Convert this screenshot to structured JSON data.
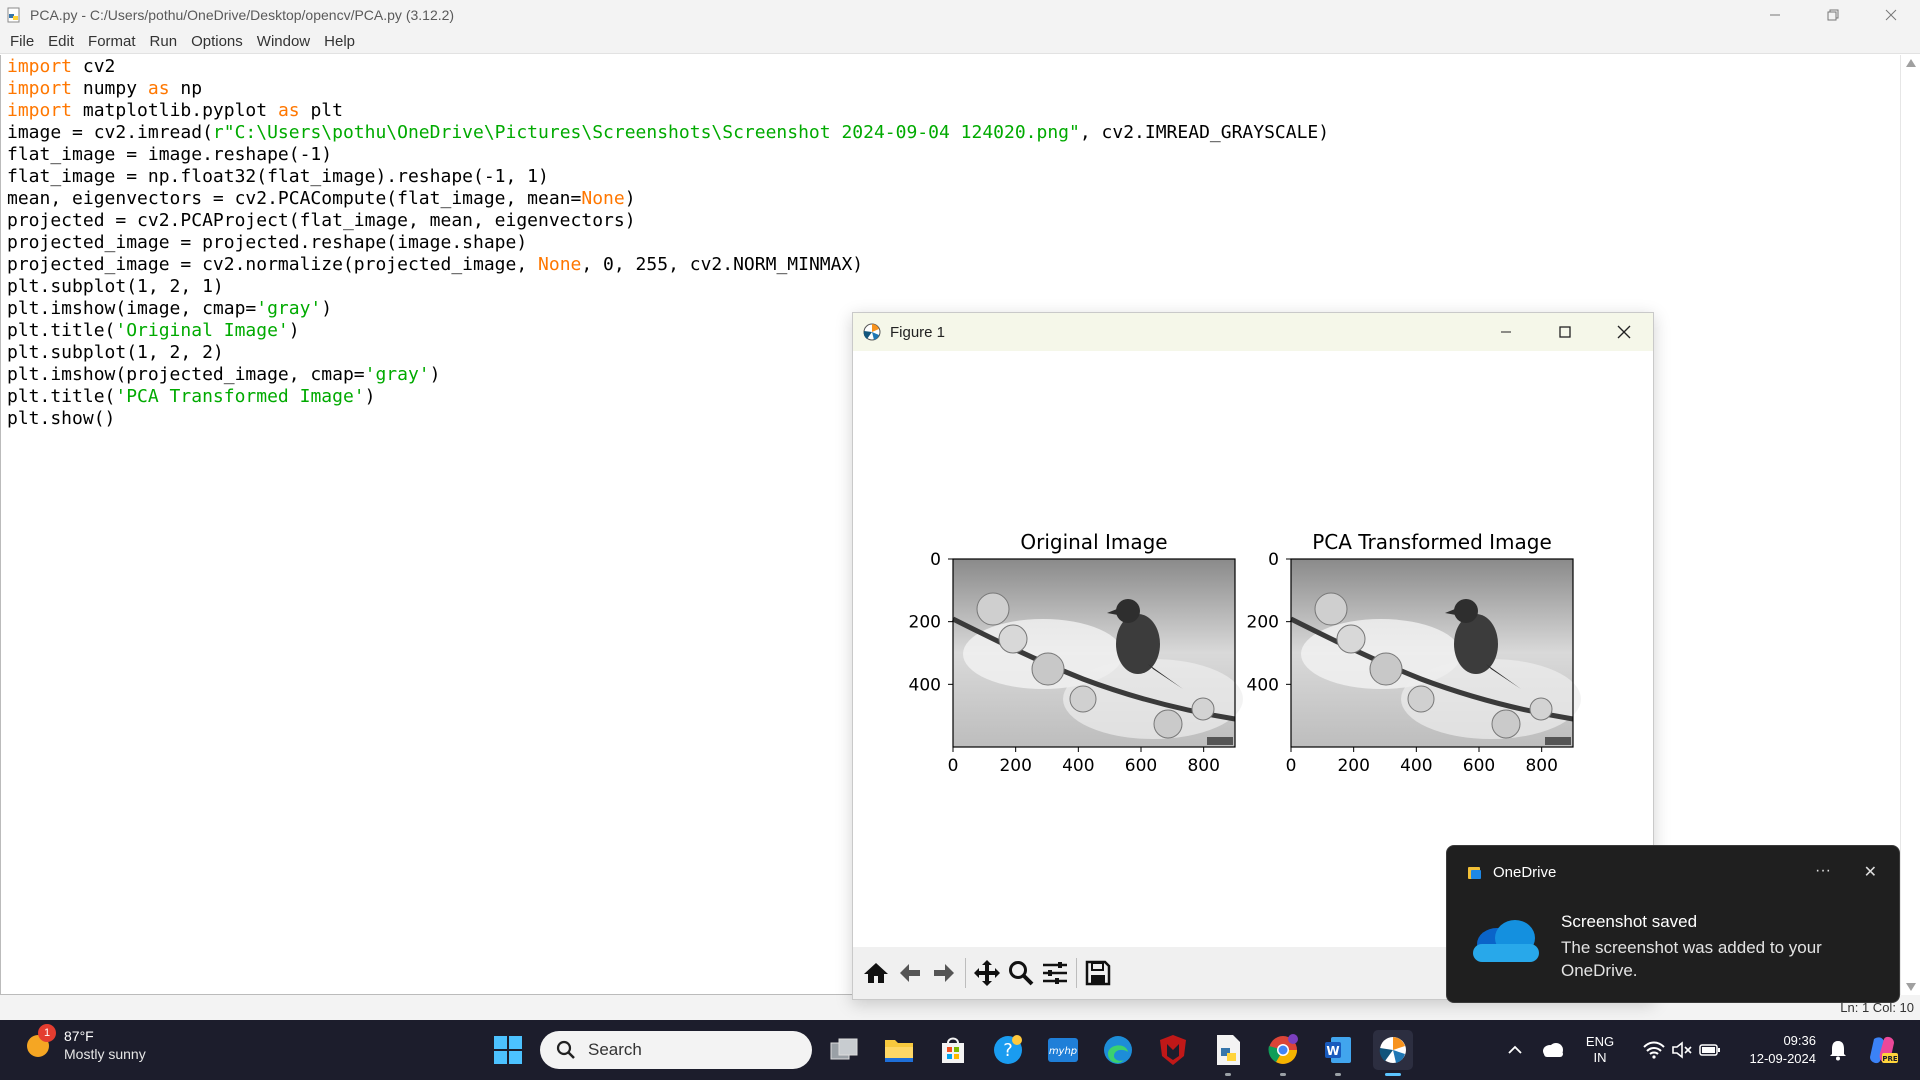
{
  "idle": {
    "title": "PCA.py - C:/Users/pothu/OneDrive/Desktop/opencv/PCA.py (3.12.2)",
    "menu": [
      "File",
      "Edit",
      "Format",
      "Run",
      "Options",
      "Window",
      "Help"
    ],
    "status": "Ln: 1   Col: 10"
  },
  "code_lines": [
    [
      {
        "t": "import",
        "c": "kw"
      },
      {
        "t": " cv2"
      }
    ],
    [
      {
        "t": "import",
        "c": "kw"
      },
      {
        "t": " numpy "
      },
      {
        "t": "as",
        "c": "kw"
      },
      {
        "t": " np"
      }
    ],
    [
      {
        "t": "import",
        "c": "kw"
      },
      {
        "t": " matplotlib.pyplot "
      },
      {
        "t": "as",
        "c": "kw"
      },
      {
        "t": " plt"
      }
    ],
    [
      {
        "t": "image = cv2.imread("
      },
      {
        "t": "r\"C:\\Users\\pothu\\OneDrive\\Pictures\\Screenshots\\Screenshot 2024-09-04 124020.png\"",
        "c": "str"
      },
      {
        "t": ", cv2.IMREAD_GRAYSCALE)"
      }
    ],
    [
      {
        "t": "flat_image = image.reshape(-1)"
      }
    ],
    [
      {
        "t": "flat_image = np.float32(flat_image).reshape(-1, 1)"
      }
    ],
    [
      {
        "t": "mean, eigenvectors = cv2.PCACompute(flat_image, mean="
      },
      {
        "t": "None",
        "c": "kw"
      },
      {
        "t": ")"
      }
    ],
    [
      {
        "t": "projected = cv2.PCAProject(flat_image, mean, eigenvectors)"
      }
    ],
    [
      {
        "t": "projected_image = projected.reshape(image.shape)"
      }
    ],
    [
      {
        "t": "projected_image = cv2.normalize(projected_image, "
      },
      {
        "t": "None",
        "c": "kw"
      },
      {
        "t": ", 0, 255, cv2.NORM_MINMAX)"
      }
    ],
    [
      {
        "t": "plt.subplot(1, 2, 1)"
      }
    ],
    [
      {
        "t": "plt.imshow(image, cmap="
      },
      {
        "t": "'gray'",
        "c": "str"
      },
      {
        "t": ")"
      }
    ],
    [
      {
        "t": "plt.title("
      },
      {
        "t": "'Original Image'",
        "c": "str"
      },
      {
        "t": ")"
      }
    ],
    [
      {
        "t": "plt.subplot(1, 2, 2)"
      }
    ],
    [
      {
        "t": "plt.imshow(projected_image, cmap="
      },
      {
        "t": "'gray'",
        "c": "str"
      },
      {
        "t": ")"
      }
    ],
    [
      {
        "t": "plt.title("
      },
      {
        "t": "'PCA Transformed Image'",
        "c": "str"
      },
      {
        "t": ")"
      }
    ],
    [
      {
        "t": "plt.show()"
      }
    ]
  ],
  "figure": {
    "window_title": "Figure 1",
    "subplots": [
      {
        "title": "Original Image",
        "xticks": [
          "0",
          "200",
          "400",
          "600",
          "800"
        ],
        "yticks": [
          "0",
          "200",
          "400"
        ]
      },
      {
        "title": "PCA Transformed Image",
        "xticks": [
          "0",
          "200",
          "400",
          "600",
          "800"
        ],
        "yticks": [
          "0",
          "200",
          "400"
        ]
      }
    ],
    "toolbar": [
      "home-icon",
      "back-icon",
      "forward-icon",
      "pan-icon",
      "zoom-icon",
      "configure-icon",
      "save-icon"
    ]
  },
  "toast": {
    "app": "OneDrive",
    "more": "···",
    "close": "✕",
    "title": "Screenshot saved",
    "body": "The screenshot was added to your OneDrive."
  },
  "taskbar": {
    "weather": {
      "badge": "1",
      "temp": "87°F",
      "condition": "Mostly sunny"
    },
    "search_placeholder": "Search",
    "lang_line1": "ENG",
    "lang_line2": "IN",
    "time": "09:36",
    "date": "12-09-2024",
    "colors": {
      "taskbar_bg": "#1c1d2c",
      "accent": "#5cc5ff"
    }
  }
}
